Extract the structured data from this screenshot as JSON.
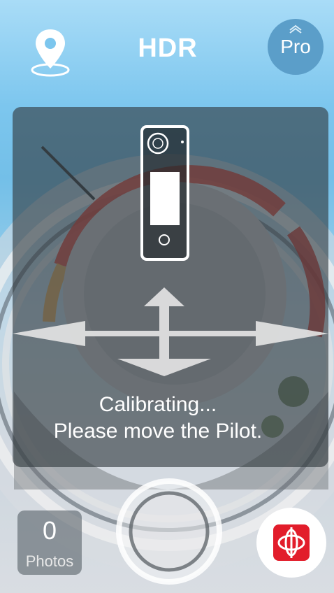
{
  "header": {
    "mode_label": "HDR",
    "pro_label": "Pro",
    "location_icon": "location-pin-icon",
    "pro_icon": "chevron-up-icon"
  },
  "calibration": {
    "line1": "Calibrating...",
    "line2": "Please move the Pilot.",
    "device_icon": "camera-device-icon",
    "arrows_icon": "move-arrows-icon"
  },
  "bottom": {
    "photos_count": "0",
    "photos_label": "Photos",
    "shutter_icon": "shutter-icon",
    "mode_icon": "gimbal-icon"
  },
  "colors": {
    "mode_button": "#e21d2b",
    "pro_button": "#5b9ec9",
    "panel": "#30383e"
  }
}
